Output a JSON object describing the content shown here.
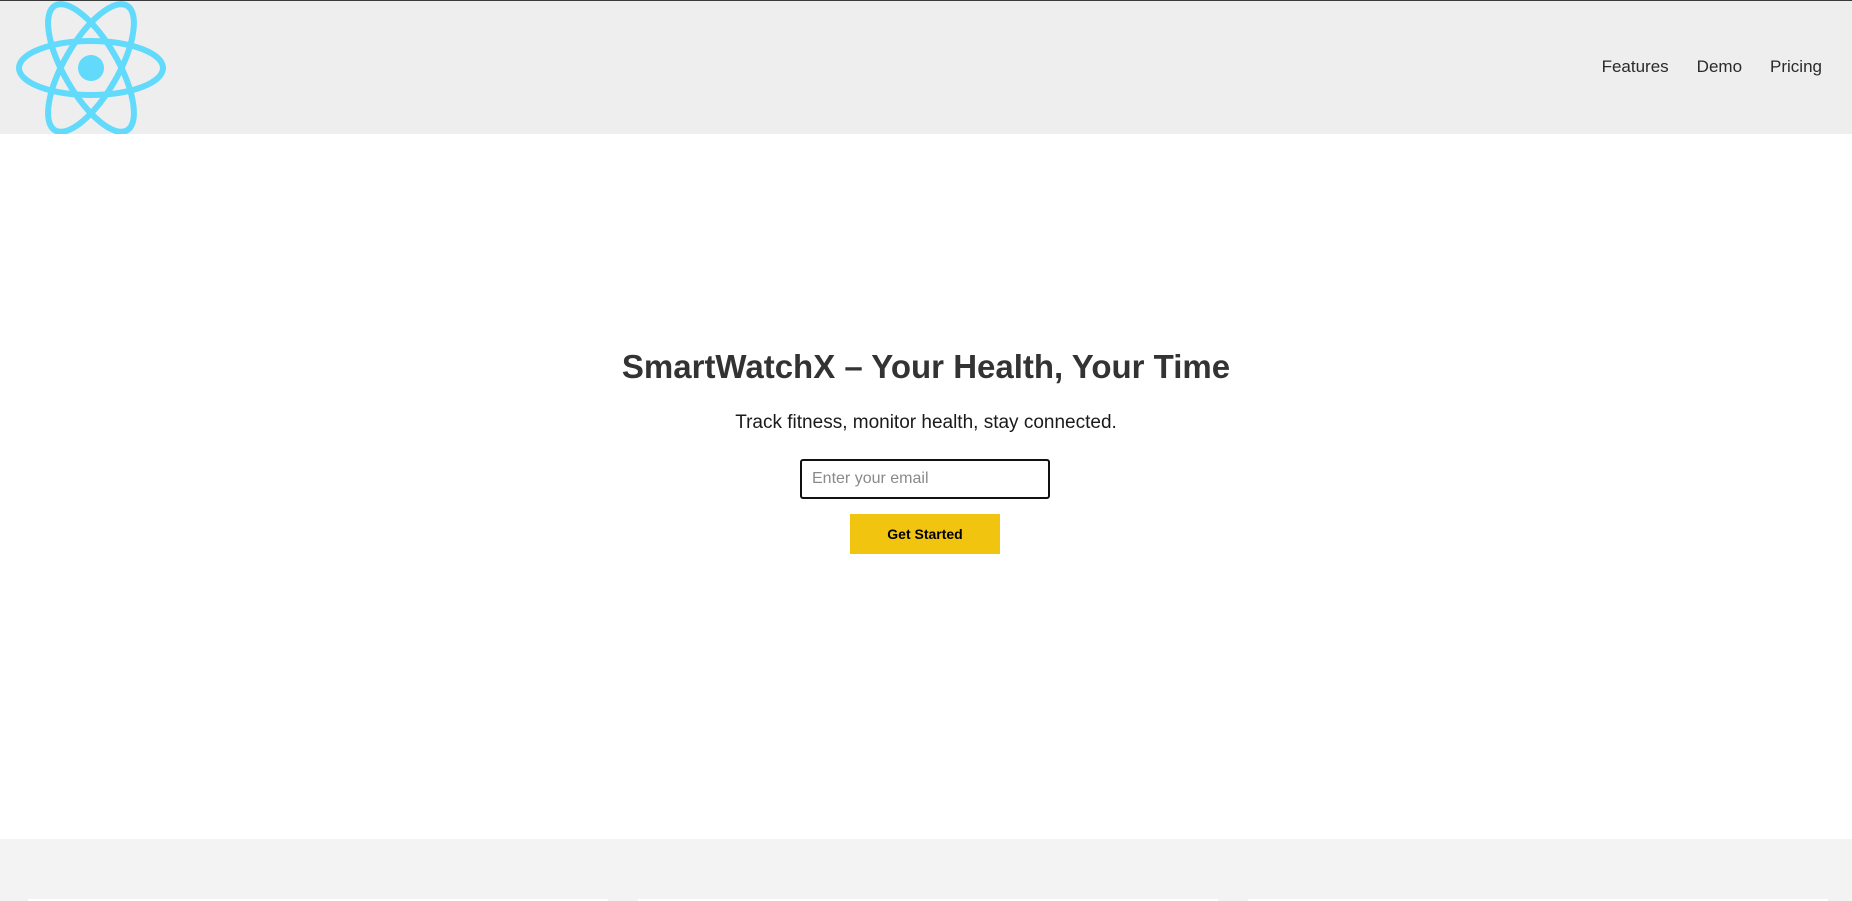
{
  "brand": {
    "logo_icon": "react-atom-icon",
    "logo_color": "#61dafb"
  },
  "nav": {
    "items": [
      {
        "label": "Features"
      },
      {
        "label": "Demo"
      },
      {
        "label": "Pricing"
      }
    ]
  },
  "hero": {
    "title": "SmartWatchX – Your Health, Your Time",
    "subtitle": "Track fitness, monitor health, stay connected.",
    "email_placeholder": "Enter your email",
    "email_value": "",
    "cta_label": "Get Started",
    "cta_color": "#f0c40f"
  },
  "colors": {
    "header_bg": "#eeeeee",
    "footer_band_bg": "#f3f3f3",
    "text": "#333333"
  }
}
